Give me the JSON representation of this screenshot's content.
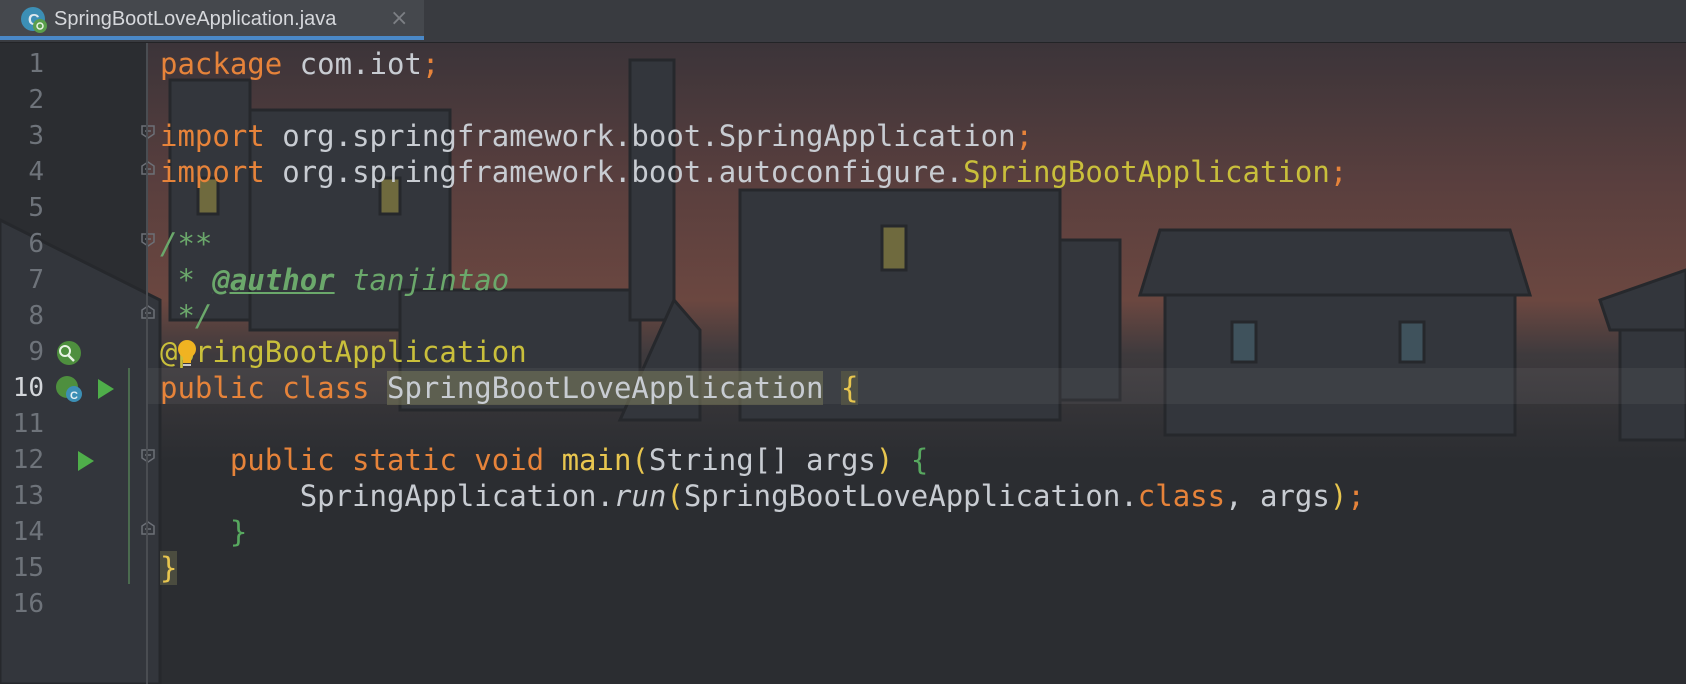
{
  "tab": {
    "filename": "SpringBootLoveApplication.java",
    "close_icon": "×"
  },
  "gutter": {
    "line_numbers": [
      "1",
      "2",
      "3",
      "4",
      "5",
      "6",
      "7",
      "8",
      "9",
      "10",
      "11",
      "12",
      "13",
      "14",
      "15",
      "16"
    ],
    "current_line": "10"
  },
  "code": {
    "l1": {
      "kw": "package",
      "rest": " com.iot",
      "semi": ";"
    },
    "l3": {
      "kw": "import",
      "rest": " org.springframework.boot.SpringApplication",
      "semi": ";"
    },
    "l4": {
      "kw": "import",
      "rest": " org.springframework.boot.autoconfigure.",
      "cls": "SpringBootApplication",
      "semi": ";"
    },
    "l6": {
      "text": "/**"
    },
    "l7": {
      "star": " * ",
      "tag": "@author",
      "name": " tanjintao"
    },
    "l8": {
      "text": " */"
    },
    "l9": {
      "at": "@",
      "ann": "pringBootApplication"
    },
    "l10": {
      "kw": "public class ",
      "name": "SpringBootLoveApplication",
      "sp": " ",
      "brace": "{"
    },
    "l12": {
      "indent": "    ",
      "kw": "public static void ",
      "meth": "main",
      "paren1": "(",
      "params": "String[] args",
      "paren2": ")",
      "sp": " ",
      "brace": "{"
    },
    "l13": {
      "indent": "        ",
      "obj": "SpringApplication.",
      "call": "run",
      "p1": "(",
      "arg1": "SpringBootLoveApplication.",
      "kwcls": "class",
      "arg2": ", args",
      "p2": ")",
      "semi": ";"
    },
    "l14": {
      "indent": "    ",
      "brace": "}"
    },
    "l15": {
      "brace": "}"
    }
  },
  "colors": {
    "keyword": "#e6833a",
    "annotation": "#c9bf3b",
    "comment": "#6ba86b",
    "brace": "#e8c64f",
    "accent": "#4a88c7"
  }
}
